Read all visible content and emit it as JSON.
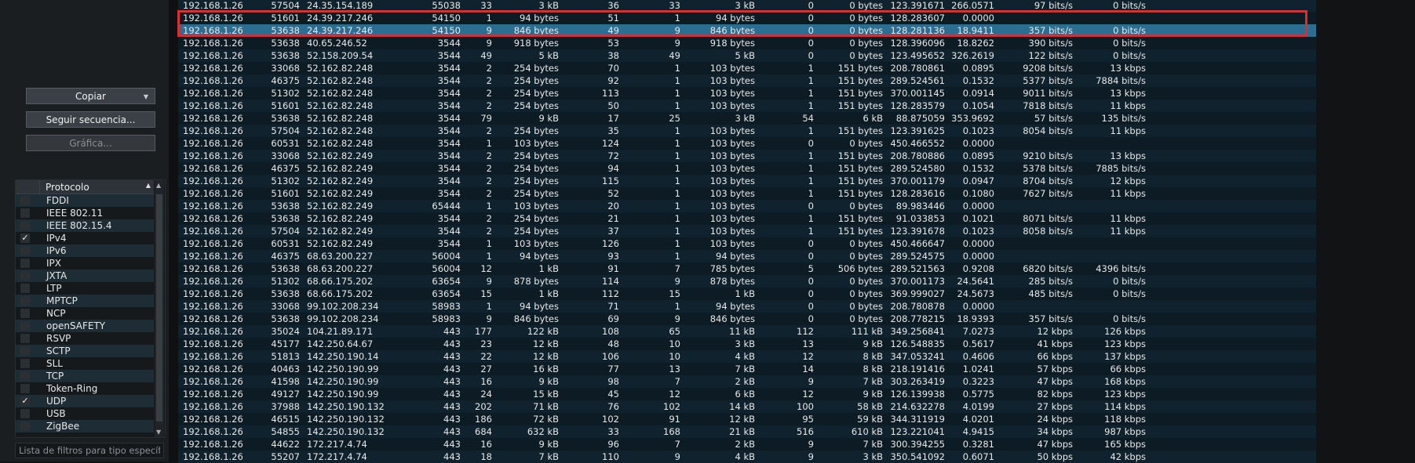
{
  "buttons": {
    "copy": "Copiar",
    "follow_stream": "Seguir secuencia...",
    "graph": "Gráfica..."
  },
  "protocol_panel": {
    "header": "Protocolo",
    "items": [
      {
        "name": "FDDI",
        "checked": false
      },
      {
        "name": "IEEE 802.11",
        "checked": false
      },
      {
        "name": "IEEE 802.15.4",
        "checked": false
      },
      {
        "name": "IPv4",
        "checked": true
      },
      {
        "name": "IPv6",
        "checked": false
      },
      {
        "name": "IPX",
        "checked": false
      },
      {
        "name": "JXTA",
        "checked": false
      },
      {
        "name": "LTP",
        "checked": false
      },
      {
        "name": "MPTCP",
        "checked": false
      },
      {
        "name": "NCP",
        "checked": false
      },
      {
        "name": "openSAFETY",
        "checked": false
      },
      {
        "name": "RSVP",
        "checked": false
      },
      {
        "name": "SCTP",
        "checked": false
      },
      {
        "name": "SLL",
        "checked": false
      },
      {
        "name": "TCP",
        "checked": false
      },
      {
        "name": "Token-Ring",
        "checked": false
      },
      {
        "name": "UDP",
        "checked": true
      },
      {
        "name": "USB",
        "checked": false
      },
      {
        "name": "ZigBee",
        "checked": false
      }
    ],
    "check_glyph": "✓"
  },
  "filter": {
    "placeholder": "Lista de filtros para tipo específico"
  },
  "table": {
    "selected_row": 2,
    "highlighted_rows": [
      1,
      2
    ],
    "rows": [
      [
        "192.168.1.26",
        "57504",
        "24.35.154.189",
        "55038",
        "33",
        "3 kB",
        "36",
        "33",
        "3 kB",
        "0",
        "0 bytes",
        "123.391671",
        "266.0571",
        "97 bits/s",
        "0 bits/s"
      ],
      [
        "192.168.1.26",
        "51601",
        "24.39.217.246",
        "54150",
        "1",
        "94 bytes",
        "51",
        "1",
        "94 bytes",
        "0",
        "0 bytes",
        "128.283607",
        "0.0000",
        "",
        ""
      ],
      [
        "192.168.1.26",
        "53638",
        "24.39.217.246",
        "54150",
        "9",
        "846 bytes",
        "49",
        "9",
        "846 bytes",
        "0",
        "0 bytes",
        "128.281136",
        "18.9411",
        "357 bits/s",
        "0 bits/s"
      ],
      [
        "192.168.1.26",
        "53638",
        "40.65.246.52",
        "3544",
        "9",
        "918 bytes",
        "53",
        "9",
        "918 bytes",
        "0",
        "0 bytes",
        "128.396096",
        "18.8262",
        "390 bits/s",
        "0 bits/s"
      ],
      [
        "192.168.1.26",
        "53638",
        "52.158.209.54",
        "3544",
        "49",
        "5 kB",
        "38",
        "49",
        "5 kB",
        "0",
        "0 bytes",
        "123.495652",
        "326.2619",
        "122 bits/s",
        "0 bits/s"
      ],
      [
        "192.168.1.26",
        "33068",
        "52.162.82.248",
        "3544",
        "2",
        "254 bytes",
        "70",
        "1",
        "103 bytes",
        "1",
        "151 bytes",
        "208.780861",
        "0.0895",
        "9208 bits/s",
        "13 kbps"
      ],
      [
        "192.168.1.26",
        "46375",
        "52.162.82.248",
        "3544",
        "2",
        "254 bytes",
        "92",
        "1",
        "103 bytes",
        "1",
        "151 bytes",
        "289.524561",
        "0.1532",
        "5377 bits/s",
        "7884 bits/s"
      ],
      [
        "192.168.1.26",
        "51302",
        "52.162.82.248",
        "3544",
        "2",
        "254 bytes",
        "113",
        "1",
        "103 bytes",
        "1",
        "151 bytes",
        "370.001145",
        "0.0914",
        "9011 bits/s",
        "13 kbps"
      ],
      [
        "192.168.1.26",
        "51601",
        "52.162.82.248",
        "3544",
        "2",
        "254 bytes",
        "50",
        "1",
        "103 bytes",
        "1",
        "151 bytes",
        "128.283579",
        "0.1054",
        "7818 bits/s",
        "11 kbps"
      ],
      [
        "192.168.1.26",
        "53638",
        "52.162.82.248",
        "3544",
        "79",
        "9 kB",
        "17",
        "25",
        "3 kB",
        "54",
        "6 kB",
        "88.875059",
        "353.9692",
        "57 bits/s",
        "135 bits/s"
      ],
      [
        "192.168.1.26",
        "57504",
        "52.162.82.248",
        "3544",
        "2",
        "254 bytes",
        "35",
        "1",
        "103 bytes",
        "1",
        "151 bytes",
        "123.391625",
        "0.1023",
        "8054 bits/s",
        "11 kbps"
      ],
      [
        "192.168.1.26",
        "60531",
        "52.162.82.248",
        "3544",
        "1",
        "103 bytes",
        "124",
        "1",
        "103 bytes",
        "0",
        "0 bytes",
        "450.466552",
        "0.0000",
        "",
        ""
      ],
      [
        "192.168.1.26",
        "33068",
        "52.162.82.249",
        "3544",
        "2",
        "254 bytes",
        "72",
        "1",
        "103 bytes",
        "1",
        "151 bytes",
        "208.780886",
        "0.0895",
        "9210 bits/s",
        "13 kbps"
      ],
      [
        "192.168.1.26",
        "46375",
        "52.162.82.249",
        "3544",
        "2",
        "254 bytes",
        "94",
        "1",
        "103 bytes",
        "1",
        "151 bytes",
        "289.524580",
        "0.1532",
        "5378 bits/s",
        "7885 bits/s"
      ],
      [
        "192.168.1.26",
        "51302",
        "52.162.82.249",
        "3544",
        "2",
        "254 bytes",
        "115",
        "1",
        "103 bytes",
        "1",
        "151 bytes",
        "370.001179",
        "0.0947",
        "8704 bits/s",
        "12 kbps"
      ],
      [
        "192.168.1.26",
        "51601",
        "52.162.82.249",
        "3544",
        "2",
        "254 bytes",
        "52",
        "1",
        "103 bytes",
        "1",
        "151 bytes",
        "128.283616",
        "0.1080",
        "7627 bits/s",
        "11 kbps"
      ],
      [
        "192.168.1.26",
        "53638",
        "52.162.82.249",
        "65444",
        "1",
        "103 bytes",
        "20",
        "1",
        "103 bytes",
        "0",
        "0 bytes",
        "89.983446",
        "0.0000",
        "",
        ""
      ],
      [
        "192.168.1.26",
        "53638",
        "52.162.82.249",
        "3544",
        "2",
        "254 bytes",
        "21",
        "1",
        "103 bytes",
        "1",
        "151 bytes",
        "91.033853",
        "0.1021",
        "8071 bits/s",
        "11 kbps"
      ],
      [
        "192.168.1.26",
        "57504",
        "52.162.82.249",
        "3544",
        "2",
        "254 bytes",
        "37",
        "1",
        "103 bytes",
        "1",
        "151 bytes",
        "123.391678",
        "0.1023",
        "8058 bits/s",
        "11 kbps"
      ],
      [
        "192.168.1.26",
        "60531",
        "52.162.82.249",
        "3544",
        "1",
        "103 bytes",
        "126",
        "1",
        "103 bytes",
        "0",
        "0 bytes",
        "450.466647",
        "0.0000",
        "",
        ""
      ],
      [
        "192.168.1.26",
        "46375",
        "68.63.200.227",
        "56004",
        "1",
        "94 bytes",
        "93",
        "1",
        "94 bytes",
        "0",
        "0 bytes",
        "289.524575",
        "0.0000",
        "",
        ""
      ],
      [
        "192.168.1.26",
        "53638",
        "68.63.200.227",
        "56004",
        "12",
        "1 kB",
        "91",
        "7",
        "785 bytes",
        "5",
        "506 bytes",
        "289.521563",
        "0.9208",
        "6820 bits/s",
        "4396 bits/s"
      ],
      [
        "192.168.1.26",
        "51302",
        "68.66.175.202",
        "63654",
        "9",
        "878 bytes",
        "114",
        "9",
        "878 bytes",
        "0",
        "0 bytes",
        "370.001173",
        "24.5641",
        "285 bits/s",
        "0 bits/s"
      ],
      [
        "192.168.1.26",
        "53638",
        "68.66.175.202",
        "63654",
        "15",
        "1 kB",
        "112",
        "15",
        "1 kB",
        "0",
        "0 bytes",
        "369.999027",
        "24.5673",
        "485 bits/s",
        "0 bits/s"
      ],
      [
        "192.168.1.26",
        "33068",
        "99.102.208.234",
        "58983",
        "1",
        "94 bytes",
        "71",
        "1",
        "94 bytes",
        "0",
        "0 bytes",
        "208.780878",
        "0.0000",
        "",
        ""
      ],
      [
        "192.168.1.26",
        "53638",
        "99.102.208.234",
        "58983",
        "9",
        "846 bytes",
        "69",
        "9",
        "846 bytes",
        "0",
        "0 bytes",
        "208.778215",
        "18.9393",
        "357 bits/s",
        "0 bits/s"
      ],
      [
        "192.168.1.26",
        "35024",
        "104.21.89.171",
        "443",
        "177",
        "122 kB",
        "108",
        "65",
        "11 kB",
        "112",
        "111 kB",
        "349.256841",
        "7.0273",
        "12 kbps",
        "126 kbps"
      ],
      [
        "192.168.1.26",
        "45177",
        "142.250.64.67",
        "443",
        "23",
        "12 kB",
        "48",
        "10",
        "3 kB",
        "13",
        "9 kB",
        "126.548835",
        "0.5617",
        "41 kbps",
        "123 kbps"
      ],
      [
        "192.168.1.26",
        "51813",
        "142.250.190.14",
        "443",
        "22",
        "12 kB",
        "106",
        "10",
        "4 kB",
        "12",
        "8 kB",
        "347.053241",
        "0.4606",
        "66 kbps",
        "137 kbps"
      ],
      [
        "192.168.1.26",
        "40463",
        "142.250.190.99",
        "443",
        "27",
        "16 kB",
        "77",
        "13",
        "7 kB",
        "14",
        "8 kB",
        "218.191416",
        "1.0241",
        "57 kbps",
        "66 kbps"
      ],
      [
        "192.168.1.26",
        "41598",
        "142.250.190.99",
        "443",
        "16",
        "9 kB",
        "98",
        "7",
        "2 kB",
        "9",
        "7 kB",
        "303.263419",
        "0.3223",
        "47 kbps",
        "168 kbps"
      ],
      [
        "192.168.1.26",
        "49127",
        "142.250.190.99",
        "443",
        "24",
        "15 kB",
        "45",
        "12",
        "6 kB",
        "12",
        "9 kB",
        "126.139938",
        "0.5775",
        "82 kbps",
        "123 kbps"
      ],
      [
        "192.168.1.26",
        "37988",
        "142.250.190.132",
        "443",
        "202",
        "71 kB",
        "76",
        "102",
        "14 kB",
        "100",
        "58 kB",
        "214.632278",
        "4.0199",
        "27 kbps",
        "114 kbps"
      ],
      [
        "192.168.1.26",
        "46515",
        "142.250.190.132",
        "443",
        "186",
        "72 kB",
        "102",
        "91",
        "12 kB",
        "95",
        "59 kB",
        "344.311919",
        "4.0201",
        "24 kbps",
        "118 kbps"
      ],
      [
        "192.168.1.26",
        "54855",
        "142.250.190.132",
        "443",
        "684",
        "632 kB",
        "33",
        "168",
        "21 kB",
        "516",
        "610 kB",
        "123.221041",
        "4.9415",
        "34 kbps",
        "987 kbps"
      ],
      [
        "192.168.1.26",
        "44622",
        "172.217.4.74",
        "443",
        "16",
        "9 kB",
        "96",
        "7",
        "2 kB",
        "9",
        "7 kB",
        "300.394255",
        "0.3281",
        "47 kbps",
        "165 kbps"
      ],
      [
        "192.168.1.26",
        "55207",
        "172.217.4.74",
        "443",
        "18",
        "7 kB",
        "110",
        "9",
        "4 kB",
        "9",
        "3 kB",
        "350.541092",
        "0.6071",
        "50 kbps",
        "42 kbps"
      ]
    ]
  }
}
